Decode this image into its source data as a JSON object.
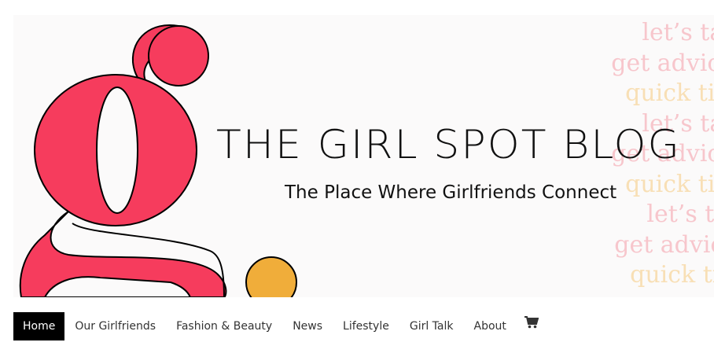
{
  "header": {
    "site_title": "THE GIRL SPOT BLOG",
    "tagline": "The Place Where Girlfriends Connect",
    "background_phrases": [
      {
        "text": "let’s talk",
        "color": "#f7c6cc"
      },
      {
        "text": "get advice",
        "color": "#f7c6cc"
      },
      {
        "text": "quick tips",
        "color": "#f8dfb5"
      },
      {
        "text": "let’s talk",
        "color": "#f7c6cc"
      },
      {
        "text": "get advice",
        "color": "#f7c6cc"
      },
      {
        "text": "quick tips",
        "color": "#f8dfb5"
      },
      {
        "text": "let’s talk",
        "color": "#f7c6cc"
      },
      {
        "text": "get advice",
        "color": "#f7c6cc"
      },
      {
        "text": "quick tips",
        "color": "#f8dfb5"
      }
    ],
    "logo_icon": "letter-g-logo-icon",
    "colors": {
      "logo_pink": "#f63c5d",
      "dot_orange": "#f0ad3a"
    }
  },
  "nav": {
    "items": [
      {
        "label": "Home",
        "active": true
      },
      {
        "label": "Our Girlfriends",
        "active": false
      },
      {
        "label": "Fashion & Beauty",
        "active": false
      },
      {
        "label": "News",
        "active": false
      },
      {
        "label": "Lifestyle",
        "active": false
      },
      {
        "label": "Girl Talk",
        "active": false
      },
      {
        "label": "About",
        "active": false
      }
    ],
    "cart_icon": "shopping-cart-icon"
  }
}
